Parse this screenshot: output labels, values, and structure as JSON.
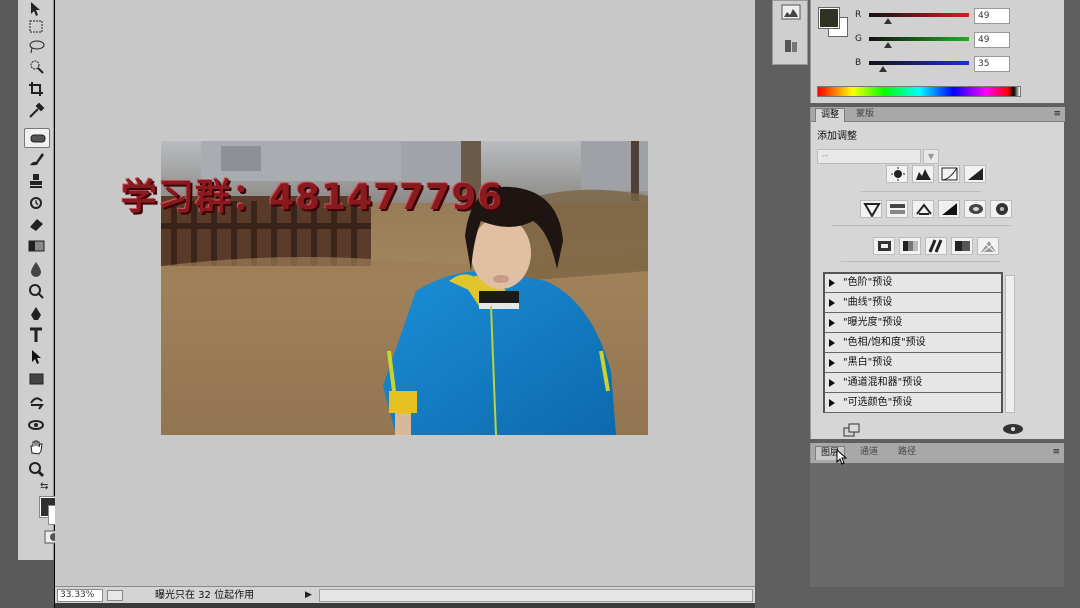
{
  "watermark": {
    "text": "学习群：481477796"
  },
  "status_bar": {
    "zoom": "33.33%",
    "message": "曝光只在 32 位起作用"
  },
  "color_panel": {
    "foreground_color": "#313123",
    "background_color": "#ffffff",
    "channels": [
      {
        "label": "R",
        "value": "49",
        "slider_color": "#d22020",
        "level": 0.19
      },
      {
        "label": "G",
        "value": "49",
        "slider_color": "#20b020",
        "level": 0.19
      },
      {
        "label": "B",
        "value": "35",
        "slider_color": "#2030d0",
        "level": 0.14
      }
    ]
  },
  "adjustments_panel": {
    "tabs": [
      {
        "label": "调整",
        "active": true
      },
      {
        "label": "蒙版",
        "active": false
      }
    ],
    "title": "添加调整",
    "preset_select": "  --",
    "icon_rows": [
      [
        "brightness-contrast-icon",
        "levels-icon",
        "curves-icon",
        "exposure-icon"
      ],
      [
        "vibrance-icon",
        "hue-saturation-icon",
        "color-balance-icon",
        "black-white-icon",
        "photo-filter-icon",
        "channel-mixer-icon"
      ],
      [
        "invert-icon",
        "posterize-icon",
        "threshold-icon",
        "gradient-map-icon",
        "selective-color-icon"
      ]
    ],
    "presets": [
      "\"色阶\"预设",
      "\"曲线\"预设",
      "\"曝光度\"预设",
      "\"色相/饱和度\"预设",
      "\"黑白\"预设",
      "\"通道混和器\"预设",
      "\"可选颜色\"预设"
    ]
  },
  "layers_panel": {
    "tabs": [
      {
        "label": "图层",
        "active": true
      },
      {
        "label": "通道",
        "active": false
      },
      {
        "label": "路径",
        "active": false
      }
    ]
  },
  "toolbox": {
    "tools": [
      "move-tool",
      "marquee-tool",
      "lasso-tool",
      "quick-select-tool",
      "crop-tool",
      "eyedropper-tool",
      "healing-brush-tool",
      "brush-tool",
      "clone-stamp-tool",
      "history-brush-tool",
      "eraser-tool",
      "gradient-tool",
      "blur-tool",
      "dodge-tool",
      "pen-tool",
      "type-tool",
      "path-select-tool",
      "shape-tool",
      "3d-rotate-tool",
      "3d-orbit-tool",
      "hand-tool",
      "zoom-tool"
    ],
    "active_tool": "healing-brush-tool"
  },
  "colors": {
    "canvas_bg": "#c8c8c8",
    "panel_bg": "#d6d6d6",
    "watermark": "#8a1a1f"
  }
}
